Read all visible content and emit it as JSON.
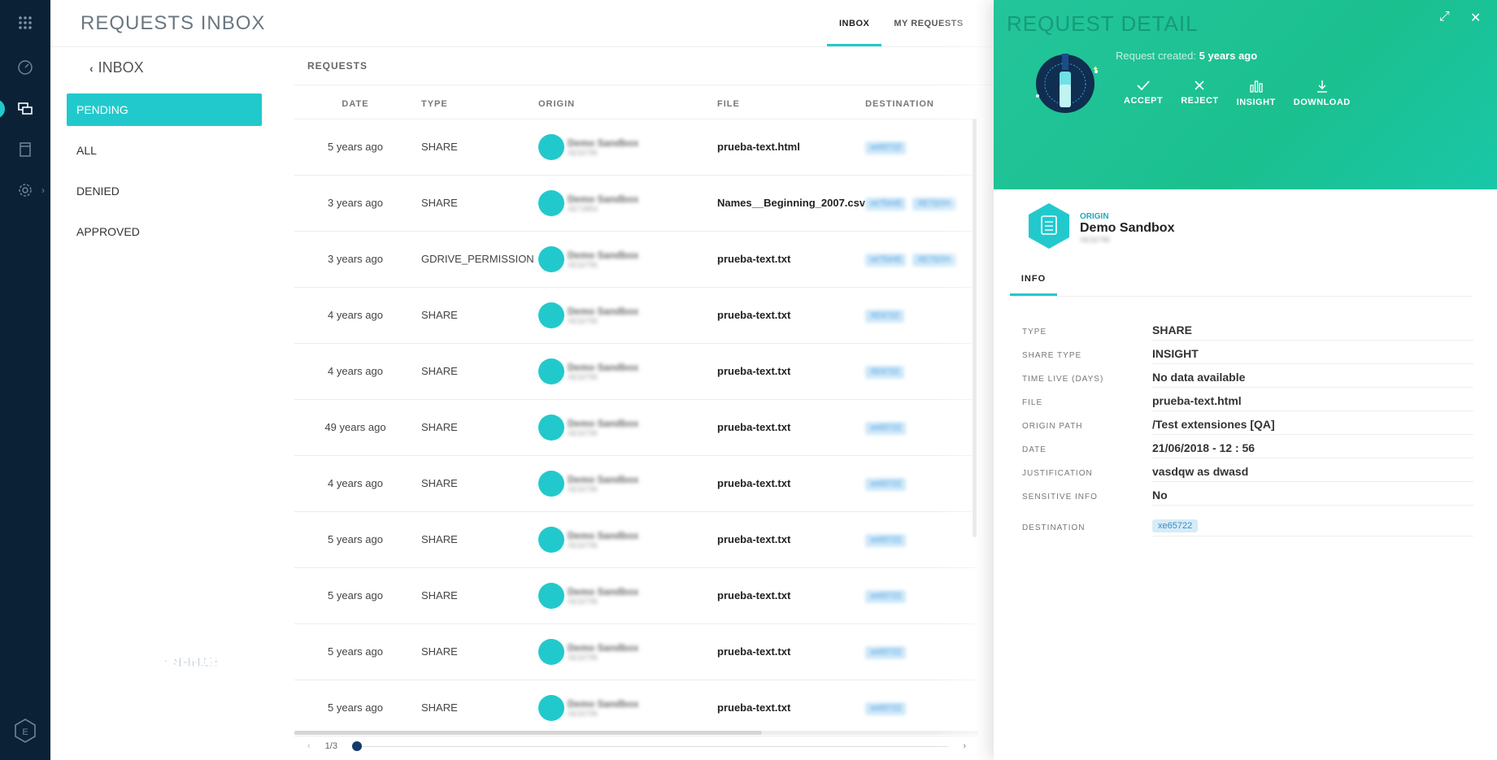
{
  "app": {
    "name_prefix": "ETHER · ",
    "name_suffix": "SANDBOX MANAGER"
  },
  "header": {
    "title": "REQUESTS INBOX",
    "tabs": [
      {
        "label": "INBOX"
      },
      {
        "label": "MY REQUESTS"
      }
    ]
  },
  "sidebar": {
    "back_label": "INBOX",
    "filters": [
      {
        "label": "PENDING"
      },
      {
        "label": "ALL"
      },
      {
        "label": "DENIED"
      },
      {
        "label": "APPROVED"
      }
    ]
  },
  "requests": {
    "label": "REQUESTS",
    "columns": [
      "DATE",
      "TYPE",
      "ORIGIN",
      "FILE",
      "DESTINATION"
    ],
    "rows": [
      {
        "date": "5 years ago",
        "type": "SHARE",
        "origin": "Demo Sandbox",
        "origin_sub": "XE32795",
        "file": "prueba-text.html",
        "dest": [
          "xe65722"
        ]
      },
      {
        "date": "3 years ago",
        "type": "SHARE",
        "origin": "Demo Sandbox",
        "origin_sub": "XE72854",
        "file": "Names__Beginning_2007.csv",
        "dest": [
          "xe75445",
          "XE73296"
        ]
      },
      {
        "date": "3 years ago",
        "type": "GDRIVE_PERMISSION",
        "origin": "Demo Sandbox",
        "origin_sub": "XE32795",
        "file": "prueba-text.txt",
        "dest": [
          "xe75445",
          "XE73296"
        ]
      },
      {
        "date": "4 years ago",
        "type": "SHARE",
        "origin": "Demo Sandbox",
        "origin_sub": "XE32795",
        "file": "prueba-text.txt",
        "dest": [
          "XE6722"
        ]
      },
      {
        "date": "4 years ago",
        "type": "SHARE",
        "origin": "Demo Sandbox",
        "origin_sub": "XE32795",
        "file": "prueba-text.txt",
        "dest": [
          "XE6722"
        ]
      },
      {
        "date": "49 years ago",
        "type": "SHARE",
        "origin": "Demo Sandbox",
        "origin_sub": "XE32795",
        "file": "prueba-text.txt",
        "dest": [
          "xe65722"
        ]
      },
      {
        "date": "4 years ago",
        "type": "SHARE",
        "origin": "Demo Sandbox",
        "origin_sub": "XE32795",
        "file": "prueba-text.txt",
        "dest": [
          "xe65722"
        ]
      },
      {
        "date": "5 years ago",
        "type": "SHARE",
        "origin": "Demo Sandbox",
        "origin_sub": "XE32795",
        "file": "prueba-text.txt",
        "dest": [
          "xe65722"
        ]
      },
      {
        "date": "5 years ago",
        "type": "SHARE",
        "origin": "Demo Sandbox",
        "origin_sub": "XE32795",
        "file": "prueba-text.txt",
        "dest": [
          "xe65722"
        ]
      },
      {
        "date": "5 years ago",
        "type": "SHARE",
        "origin": "Demo Sandbox",
        "origin_sub": "XE32795",
        "file": "prueba-text.txt",
        "dest": [
          "xe65722"
        ]
      },
      {
        "date": "5 years ago",
        "type": "SHARE",
        "origin": "Demo Sandbox",
        "origin_sub": "XE32795",
        "file": "prueba-text.txt",
        "dest": [
          "xe65722"
        ]
      }
    ]
  },
  "pagination": {
    "page": "1/3"
  },
  "detail": {
    "title": "REQUEST DETAIL",
    "created_label": "Request created:",
    "created_value": "5 years ago",
    "actions": [
      {
        "label": "ACCEPT"
      },
      {
        "label": "REJECT"
      },
      {
        "label": "INSIGHT"
      },
      {
        "label": "DOWNLOAD"
      }
    ],
    "origin_label": "ORIGIN",
    "origin_name": "Demo Sandbox",
    "origin_sub": "XE32795",
    "tab": "INFO",
    "fields": [
      {
        "key": "TYPE",
        "value": "SHARE"
      },
      {
        "key": "SHARE TYPE",
        "value": "INSIGHT"
      },
      {
        "key": "TIME LIVE (DAYS)",
        "value": "No data available"
      },
      {
        "key": "FILE",
        "value": "prueba-text.html"
      },
      {
        "key": "ORIGIN PATH",
        "value": "/Test extensiones [QA]"
      },
      {
        "key": "DATE",
        "value": "21/06/2018 - 12 : 56"
      },
      {
        "key": "JUSTIFICATION",
        "value": "vasdqw as dwasd"
      },
      {
        "key": "SENSITIVE INFO",
        "value": "No"
      }
    ],
    "destination_key": "DESTINATION",
    "destination_value": "xe65722"
  },
  "colors": {
    "accent": "#22c9cc",
    "rail": "#0b2236",
    "hero": "#1fc394",
    "chip_bg": "#d6ecf7",
    "pager_knob": "#123d6b"
  }
}
